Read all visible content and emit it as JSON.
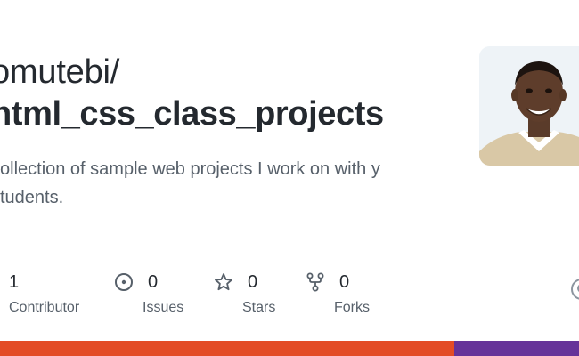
{
  "repo": {
    "owner_text": "omutebi/",
    "name": "html_css_class_projects",
    "description": "collection of sample web projects I work on with y students."
  },
  "stats": [
    {
      "count": "1",
      "label": "Contributor",
      "icon": "people-icon"
    },
    {
      "count": "0",
      "label": "Issues",
      "icon": "issue-opened-icon"
    },
    {
      "count": "0",
      "label": "Stars",
      "icon": "star-icon"
    },
    {
      "count": "0",
      "label": "Forks",
      "icon": "repo-forked-icon"
    }
  ],
  "languages": [
    {
      "color": "#e34c26",
      "share": 0.785
    },
    {
      "color": "#663399",
      "share": 0.215
    }
  ],
  "colors": {
    "title": "#24292f",
    "muted": "#57606a",
    "html_language": "#e34c26",
    "css_language": "#663399"
  }
}
